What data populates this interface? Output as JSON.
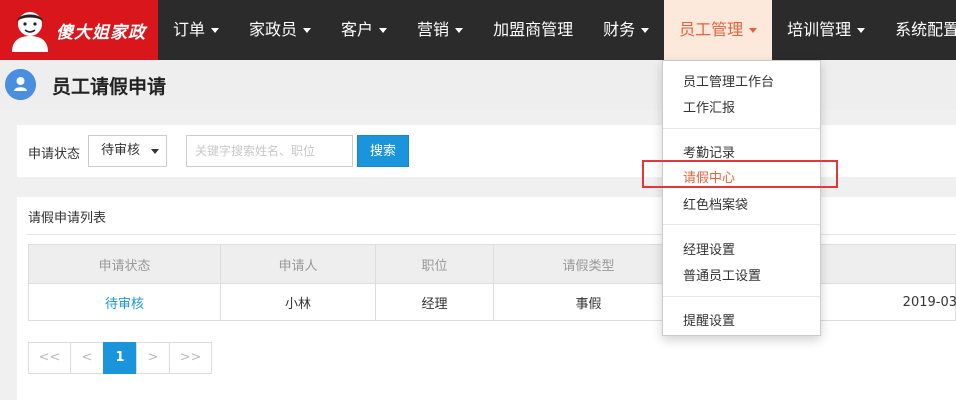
{
  "header": {
    "brand": "傻大姐家政",
    "nav": [
      {
        "label": "订单",
        "caret": true
      },
      {
        "label": "家政员",
        "caret": true
      },
      {
        "label": "客户",
        "caret": true
      },
      {
        "label": "营销",
        "caret": true
      },
      {
        "label": "加盟商管理",
        "caret": false
      },
      {
        "label": "财务",
        "caret": true
      },
      {
        "label": "员工管理",
        "caret": true,
        "active": true
      },
      {
        "label": "培训管理",
        "caret": true
      },
      {
        "label": "系统配置",
        "caret": false
      }
    ]
  },
  "page": {
    "title": "员工请假申请"
  },
  "filter": {
    "status_label": "申请状态",
    "status_value": "待审核",
    "search_placeholder": "关键字搜索姓名、职位",
    "search_button": "搜索"
  },
  "list": {
    "title": "请假申请列表",
    "columns": [
      "申请状态",
      "申请人",
      "职位",
      "请假类型",
      ""
    ],
    "rows": [
      [
        "待审核",
        "小林",
        "经理",
        "事假",
        "2019-03"
      ]
    ]
  },
  "pagination": [
    "<<",
    "<",
    "1",
    ">",
    ">>"
  ],
  "dropdown": {
    "items": [
      "员工管理工作台",
      "工作汇报",
      "考勤记录",
      "请假中心",
      "红色档案袋",
      "经理设置",
      "普通员工设置",
      "提醒设置"
    ],
    "selected": "请假中心"
  },
  "colors": {
    "nav_bg": "#2b2b2b",
    "logo_bg": "#d9161c",
    "accent_blue": "#1a94da",
    "active_orange": "#e4633f",
    "highlight_red": "#e3383b"
  }
}
